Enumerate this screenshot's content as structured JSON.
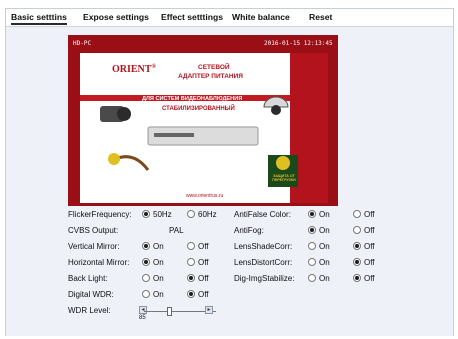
{
  "tabs": [
    "Basic setttins",
    "Expose settings",
    "Effect setttings",
    "White balance",
    "Reset"
  ],
  "video": {
    "overlay_left": "HD-PC",
    "overlay_right": "2016-01-15 12:13:45",
    "brand": "ORIENT",
    "brand_mark": "®",
    "line1": "СЕТЕВОЙ",
    "line2": "АДАПТЕР ПИТАНИЯ",
    "line3": "ДЛЯ СИСТЕМ ВИДЕОНАБЛЮДЕНИЯ",
    "line4": "СТАБИЛИЗИРОВАННЫЙ",
    "badge": "ЗАЩИТА ОТ ПЕРЕГРУЗКИ",
    "url": "www.orientrus.ru"
  },
  "left": {
    "flicker": {
      "label": "FlickerFrequency:",
      "opt1": "50Hz",
      "opt2": "60Hz",
      "selected": 1
    },
    "cvbs": {
      "label": "CVBS Output:",
      "value": "PAL"
    },
    "vmirror": {
      "label": "Vertical Mirror:",
      "opt1": "On",
      "opt2": "Off",
      "selected": 1
    },
    "hmirror": {
      "label": "Horizontal Mirror:",
      "opt1": "On",
      "opt2": "Off",
      "selected": 1
    },
    "backlight": {
      "label": "Back Light:",
      "opt1": "On",
      "opt2": "Off",
      "selected": 2
    },
    "dwdr": {
      "label": "Digital WDR:",
      "opt1": "On",
      "opt2": "Off",
      "selected": 2
    },
    "wdr_level": {
      "label": "WDR Level:",
      "value": "85",
      "fraction": 0.34
    }
  },
  "right": {
    "antifalse": {
      "label": "AntiFalse Color:",
      "opt1": "On",
      "opt2": "Off",
      "selected": 1
    },
    "antifog": {
      "label": "AntiFog:",
      "opt1": "On",
      "opt2": "Off",
      "selected": 1
    },
    "lensshade": {
      "label": "LensShadeCorr:",
      "opt1": "On",
      "opt2": "Off",
      "selected": 2
    },
    "lensdistort": {
      "label": "LensDistortCorr:",
      "opt1": "On",
      "opt2": "Off",
      "selected": 2
    },
    "digimg": {
      "label": "Dig-ImgStabilize:",
      "opt1": "On",
      "opt2": "Off",
      "selected": 2
    }
  },
  "colors": {
    "accent": "#9a0e16",
    "background": "#eef1f8"
  }
}
